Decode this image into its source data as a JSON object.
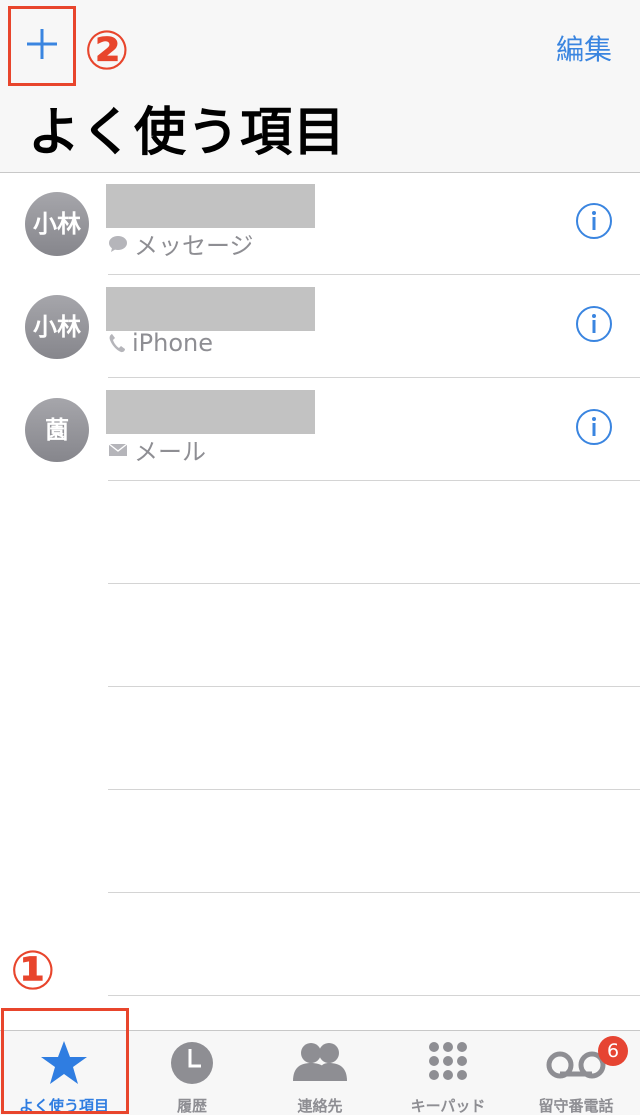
{
  "header": {
    "add_icon": "plus-icon",
    "edit_label": "編集",
    "title": "よく使う項目"
  },
  "annotations": {
    "marker_1": "①",
    "marker_2": "②"
  },
  "favorites": [
    {
      "avatar": "小林",
      "type_icon": "message-icon",
      "type_label": "メッセージ"
    },
    {
      "avatar": "小林",
      "type_icon": "phone-icon",
      "type_label": "iPhone"
    },
    {
      "avatar": "薗",
      "type_icon": "mail-icon",
      "type_label": "メール"
    }
  ],
  "tabbar": {
    "tabs": [
      {
        "label": "よく使う項目",
        "icon": "star-icon",
        "active": true
      },
      {
        "label": "履歴",
        "icon": "clock-icon"
      },
      {
        "label": "連絡先",
        "icon": "contacts-icon"
      },
      {
        "label": "キーパッド",
        "icon": "keypad-icon"
      },
      {
        "label": "留守番電話",
        "icon": "voicemail-icon",
        "badge": "6"
      }
    ]
  },
  "colors": {
    "accent": "#3a85e0",
    "annotation": "#e8452c",
    "badge": "#e64432"
  }
}
